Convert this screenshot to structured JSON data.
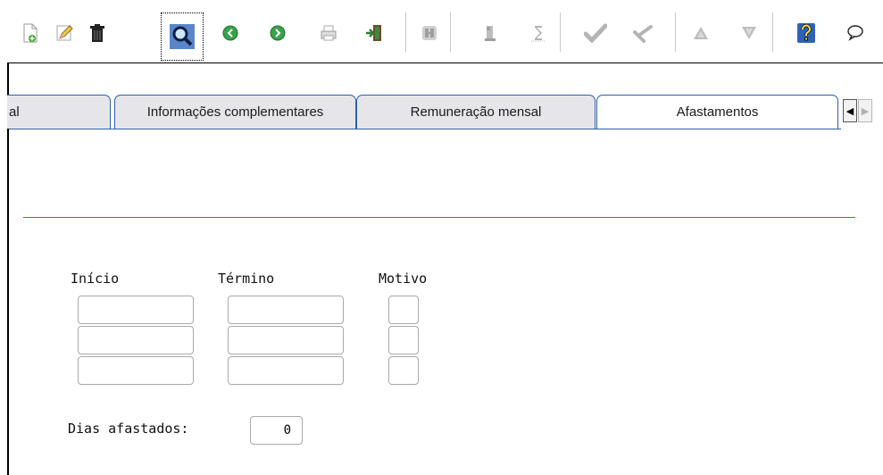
{
  "toolbar": {
    "buttons": [
      {
        "name": "new-record",
        "icon": "new-document-icon"
      },
      {
        "name": "edit-record",
        "icon": "pencil-icon"
      },
      {
        "name": "delete-record",
        "icon": "trash-icon"
      },
      {
        "name": "search",
        "icon": "magnifier-icon",
        "active": true
      },
      {
        "name": "previous-record",
        "icon": "arrow-left-circle-icon"
      },
      {
        "name": "next-record",
        "icon": "arrow-right-circle-icon"
      },
      {
        "name": "print",
        "icon": "printer-icon"
      },
      {
        "name": "exit",
        "icon": "exit-door-icon"
      },
      {
        "name": "save",
        "icon": "save-icon",
        "disabled": true
      },
      {
        "name": "info",
        "icon": "info-icon",
        "disabled": true
      },
      {
        "name": "timer",
        "icon": "hourglass-icon",
        "disabled": true
      },
      {
        "name": "confirm",
        "icon": "check-icon",
        "disabled": true
      },
      {
        "name": "cancel",
        "icon": "cancel-icon",
        "disabled": true
      },
      {
        "name": "move-up",
        "icon": "triangle-up-icon",
        "disabled": true
      },
      {
        "name": "move-down",
        "icon": "triangle-down-icon",
        "disabled": true
      },
      {
        "name": "help",
        "icon": "question-icon"
      },
      {
        "name": "chat",
        "icon": "speech-bubble-icon"
      }
    ]
  },
  "tabs": [
    {
      "label": "al",
      "active": false
    },
    {
      "label": "Informações complementares",
      "active": false
    },
    {
      "label": "Remuneração mensal",
      "active": false
    },
    {
      "label": "Afastamentos",
      "active": true
    }
  ],
  "form": {
    "labels": {
      "inicio": "Início",
      "termino": "Término",
      "motivo": "Motivo",
      "dias": "Dias afastados:"
    },
    "rows": [
      {
        "inicio": "",
        "termino": "",
        "motivo": ""
      },
      {
        "inicio": "",
        "termino": "",
        "motivo": ""
      },
      {
        "inicio": "",
        "termino": "",
        "motivo": ""
      }
    ],
    "dias_value": "0"
  },
  "colors": {
    "tab_border": "#2f5fa8",
    "divider": "#e53935",
    "field_border": "#a9a9a9"
  }
}
